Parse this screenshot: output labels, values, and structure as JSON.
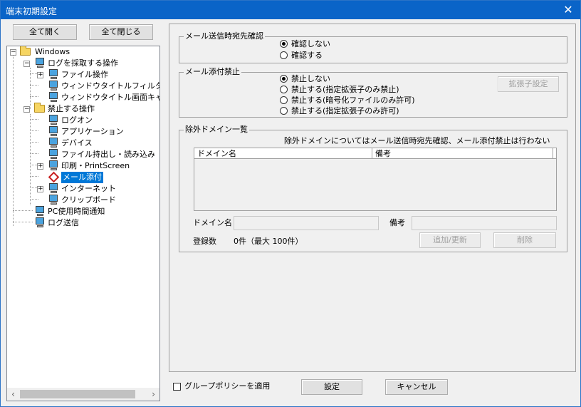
{
  "window": {
    "title": "端末初期設定",
    "close_glyph": "✕"
  },
  "toolbar": {
    "expand_all": "全て開く",
    "collapse_all": "全て閉じる"
  },
  "tree": {
    "root": "Windows",
    "log_ops": "ログを採取する操作",
    "file_ops": "ファイル操作",
    "window_title_filter": "ウィンドウタイトルフィルタ",
    "window_title_capture": "ウィンドウタイトル画面キャ",
    "prohibited_ops": "禁止する操作",
    "logon": "ログオン",
    "application": "アプリケーション",
    "device": "デバイス",
    "file_transfer": "ファイル持出し・読み込み",
    "print_screen": "印刷・PrintScreen",
    "mail_attach": "メール添付",
    "internet": "インターネット",
    "clipboard": "クリップボード",
    "pc_usage": "PC使用時間通知",
    "log_send": "ログ送信"
  },
  "scroll": {
    "left": "‹",
    "right": "›"
  },
  "mail_confirm": {
    "title": "メール送信時宛先確認",
    "options": [
      "確認しない",
      "確認する"
    ],
    "selected": 0
  },
  "mail_attach_block": {
    "title": "メール添付禁止",
    "options": [
      "禁止しない",
      "禁止する(指定拡張子のみ禁止)",
      "禁止する(暗号化ファイルのみ許可)",
      "禁止する(指定拡張子のみ許可)"
    ],
    "selected": 0,
    "ext_button": "拡張子設定"
  },
  "exclude": {
    "title": "除外ドメイン一覧",
    "note": "除外ドメインについてはメール送信時宛先確認、メール添付禁止は行わない",
    "col_domain": "ドメイン名",
    "col_note": "備考",
    "domain_label": "ドメイン名",
    "domain_value": "",
    "note_label": "備考",
    "note_value": "",
    "count_label": "登録数",
    "count_value": "0件（最大 100件）",
    "add_button": "追加/更新",
    "delete_button": "削除"
  },
  "footer": {
    "group_policy": "グループポリシーを適用",
    "group_policy_checked": false,
    "set_button": "設定",
    "cancel_button": "キャンセル"
  }
}
